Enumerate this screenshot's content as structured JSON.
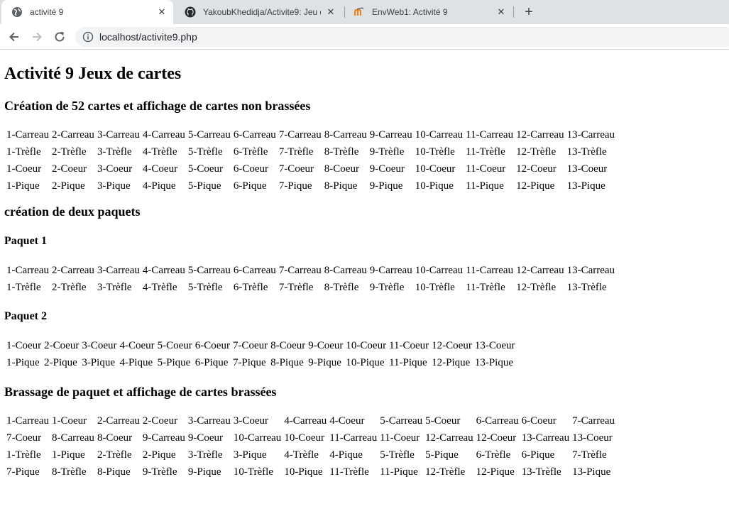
{
  "browser": {
    "tabs": [
      {
        "title": "activité 9",
        "active": true,
        "icon": "globe-icon"
      },
      {
        "title": "YakoubKhedidja/Activite9: Jeu de",
        "active": false,
        "icon": "github-icon"
      },
      {
        "title": "EnvWeb1: Activité 9",
        "active": false,
        "icon": "moodle-icon"
      }
    ],
    "new_tab": "+",
    "close_glyph": "✕",
    "url": "localhost/activite9.php"
  },
  "page": {
    "title": "Activité 9 Jeux de cartes",
    "section1": {
      "heading": "Création de 52 cartes et affichage de cartes non brassées",
      "rows": [
        [
          "1-Carreau",
          "2-Carreau",
          "3-Carreau",
          "4-Carreau",
          "5-Carreau",
          "6-Carreau",
          "7-Carreau",
          "8-Carreau",
          "9-Carreau",
          "10-Carreau",
          "11-Carreau",
          "12-Carreau",
          "13-Carreau"
        ],
        [
          "1-Trèfle",
          "2-Trèfle",
          "3-Trèfle",
          "4-Trèfle",
          "5-Trèfle",
          "6-Trèfle",
          "7-Trèfle",
          "8-Trèfle",
          "9-Trèfle",
          "10-Trèfle",
          "11-Trèfle",
          "12-Trèfle",
          "13-Trèfle"
        ],
        [
          "1-Coeur",
          "2-Coeur",
          "3-Coeur",
          "4-Coeur",
          "5-Coeur",
          "6-Coeur",
          "7-Coeur",
          "8-Coeur",
          "9-Coeur",
          "10-Coeur",
          "11-Coeur",
          "12-Coeur",
          "13-Coeur"
        ],
        [
          "1-Pique",
          "2-Pique",
          "3-Pique",
          "4-Pique",
          "5-Pique",
          "6-Pique",
          "7-Pique",
          "8-Pique",
          "9-Pique",
          "10-Pique",
          "11-Pique",
          "12-Pique",
          "13-Pique"
        ]
      ]
    },
    "section2": {
      "heading": "création de deux paquets",
      "paquet1": {
        "heading": "Paquet 1",
        "rows": [
          [
            "1-Carreau",
            "2-Carreau",
            "3-Carreau",
            "4-Carreau",
            "5-Carreau",
            "6-Carreau",
            "7-Carreau",
            "8-Carreau",
            "9-Carreau",
            "10-Carreau",
            "11-Carreau",
            "12-Carreau",
            "13-Carreau"
          ],
          [
            "1-Trèfle",
            "2-Trèfle",
            "3-Trèfle",
            "4-Trèfle",
            "5-Trèfle",
            "6-Trèfle",
            "7-Trèfle",
            "8-Trèfle",
            "9-Trèfle",
            "10-Trèfle",
            "11-Trèfle",
            "12-Trèfle",
            "13-Trèfle"
          ]
        ]
      },
      "paquet2": {
        "heading": "Paquet 2",
        "rows": [
          [
            "1-Coeur",
            "2-Coeur",
            "3-Coeur",
            "4-Coeur",
            "5-Coeur",
            "6-Coeur",
            "7-Coeur",
            "8-Coeur",
            "9-Coeur",
            "10-Coeur",
            "11-Coeur",
            "12-Coeur",
            "13-Coeur"
          ],
          [
            "1-Pique",
            "2-Pique",
            "3-Pique",
            "4-Pique",
            "5-Pique",
            "6-Pique",
            "7-Pique",
            "8-Pique",
            "9-Pique",
            "10-Pique",
            "11-Pique",
            "12-Pique",
            "13-Pique"
          ]
        ]
      }
    },
    "section3": {
      "heading": "Brassage de paquet et affichage de cartes brassées",
      "rows": [
        [
          "1-Carreau",
          "1-Coeur",
          "2-Carreau",
          "2-Coeur",
          "3-Carreau",
          "3-Coeur",
          "4-Carreau",
          "4-Coeur",
          "5-Carreau",
          "5-Coeur",
          "6-Carreau",
          "6-Coeur",
          "7-Carreau"
        ],
        [
          "7-Coeur",
          "8-Carreau",
          "8-Coeur",
          "9-Carreau",
          "9-Coeur",
          "10-Carreau",
          "10-Coeur",
          "11-Carreau",
          "11-Coeur",
          "12-Carreau",
          "12-Coeur",
          "13-Carreau",
          "13-Coeur"
        ],
        [
          "1-Trèfle",
          "1-Pique",
          "2-Trèfle",
          "2-Pique",
          "3-Trèfle",
          "3-Pique",
          "4-Trèfle",
          "4-Pique",
          "5-Trèfle",
          "5-Pique",
          "6-Trèfle",
          "6-Pique",
          "7-Trèfle"
        ],
        [
          "7-Pique",
          "8-Trèfle",
          "8-Pique",
          "9-Trèfle",
          "9-Pique",
          "10-Trèfle",
          "10-Pique",
          "11-Trèfle",
          "11-Pique",
          "12-Trèfle",
          "12-Pique",
          "13-Trèfle",
          "13-Pique"
        ]
      ]
    }
  }
}
